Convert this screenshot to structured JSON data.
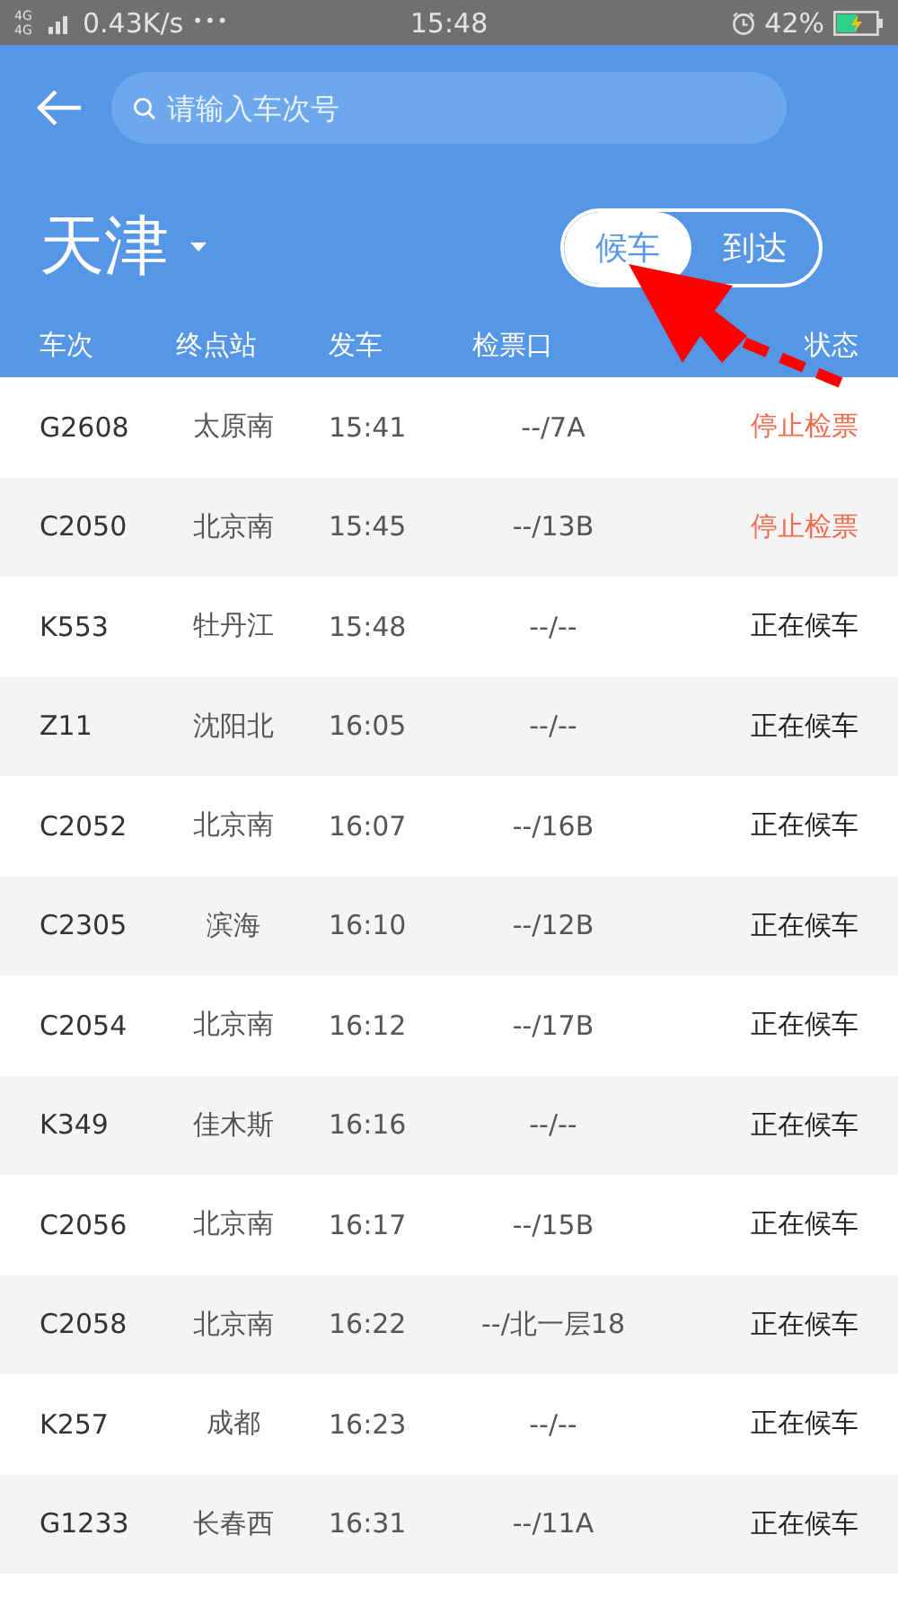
{
  "status_bar": {
    "network": "4G 4G",
    "speed": "0.43K/s",
    "dots": "•••",
    "time": "15:48",
    "battery": "42%"
  },
  "search": {
    "placeholder": "请输入车次号"
  },
  "station": {
    "name": "天津"
  },
  "tabs": [
    {
      "label": "候车",
      "selected": true
    },
    {
      "label": "到达",
      "selected": false
    }
  ],
  "table": {
    "columns": [
      "车次",
      "终点站",
      "发车",
      "检票口",
      "状态"
    ],
    "rows": [
      {
        "train": "G2608",
        "terminal": "太原南",
        "departure": "15:41",
        "gate": "--/7A",
        "status": "停止检票",
        "stopped": true
      },
      {
        "train": "C2050",
        "terminal": "北京南",
        "departure": "15:45",
        "gate": "--/13B",
        "status": "停止检票",
        "stopped": true
      },
      {
        "train": "K553",
        "terminal": "牡丹江",
        "departure": "15:48",
        "gate": "--/--",
        "status": "正在候车",
        "stopped": false
      },
      {
        "train": "Z11",
        "terminal": "沈阳北",
        "departure": "16:05",
        "gate": "--/--",
        "status": "正在候车",
        "stopped": false
      },
      {
        "train": "C2052",
        "terminal": "北京南",
        "departure": "16:07",
        "gate": "--/16B",
        "status": "正在候车",
        "stopped": false
      },
      {
        "train": "C2305",
        "terminal": "滨海",
        "departure": "16:10",
        "gate": "--/12B",
        "status": "正在候车",
        "stopped": false
      },
      {
        "train": "C2054",
        "terminal": "北京南",
        "departure": "16:12",
        "gate": "--/17B",
        "status": "正在候车",
        "stopped": false
      },
      {
        "train": "K349",
        "terminal": "佳木斯",
        "departure": "16:16",
        "gate": "--/--",
        "status": "正在候车",
        "stopped": false
      },
      {
        "train": "C2056",
        "terminal": "北京南",
        "departure": "16:17",
        "gate": "--/15B",
        "status": "正在候车",
        "stopped": false
      },
      {
        "train": "C2058",
        "terminal": "北京南",
        "departure": "16:22",
        "gate": "--/北一层18",
        "status": "正在候车",
        "stopped": false
      },
      {
        "train": "K257",
        "terminal": "成都",
        "departure": "16:23",
        "gate": "--/--",
        "status": "正在候车",
        "stopped": false
      },
      {
        "train": "G1233",
        "terminal": "长春西",
        "departure": "16:31",
        "gate": "--/11A",
        "status": "正在候车",
        "stopped": false
      }
    ]
  }
}
